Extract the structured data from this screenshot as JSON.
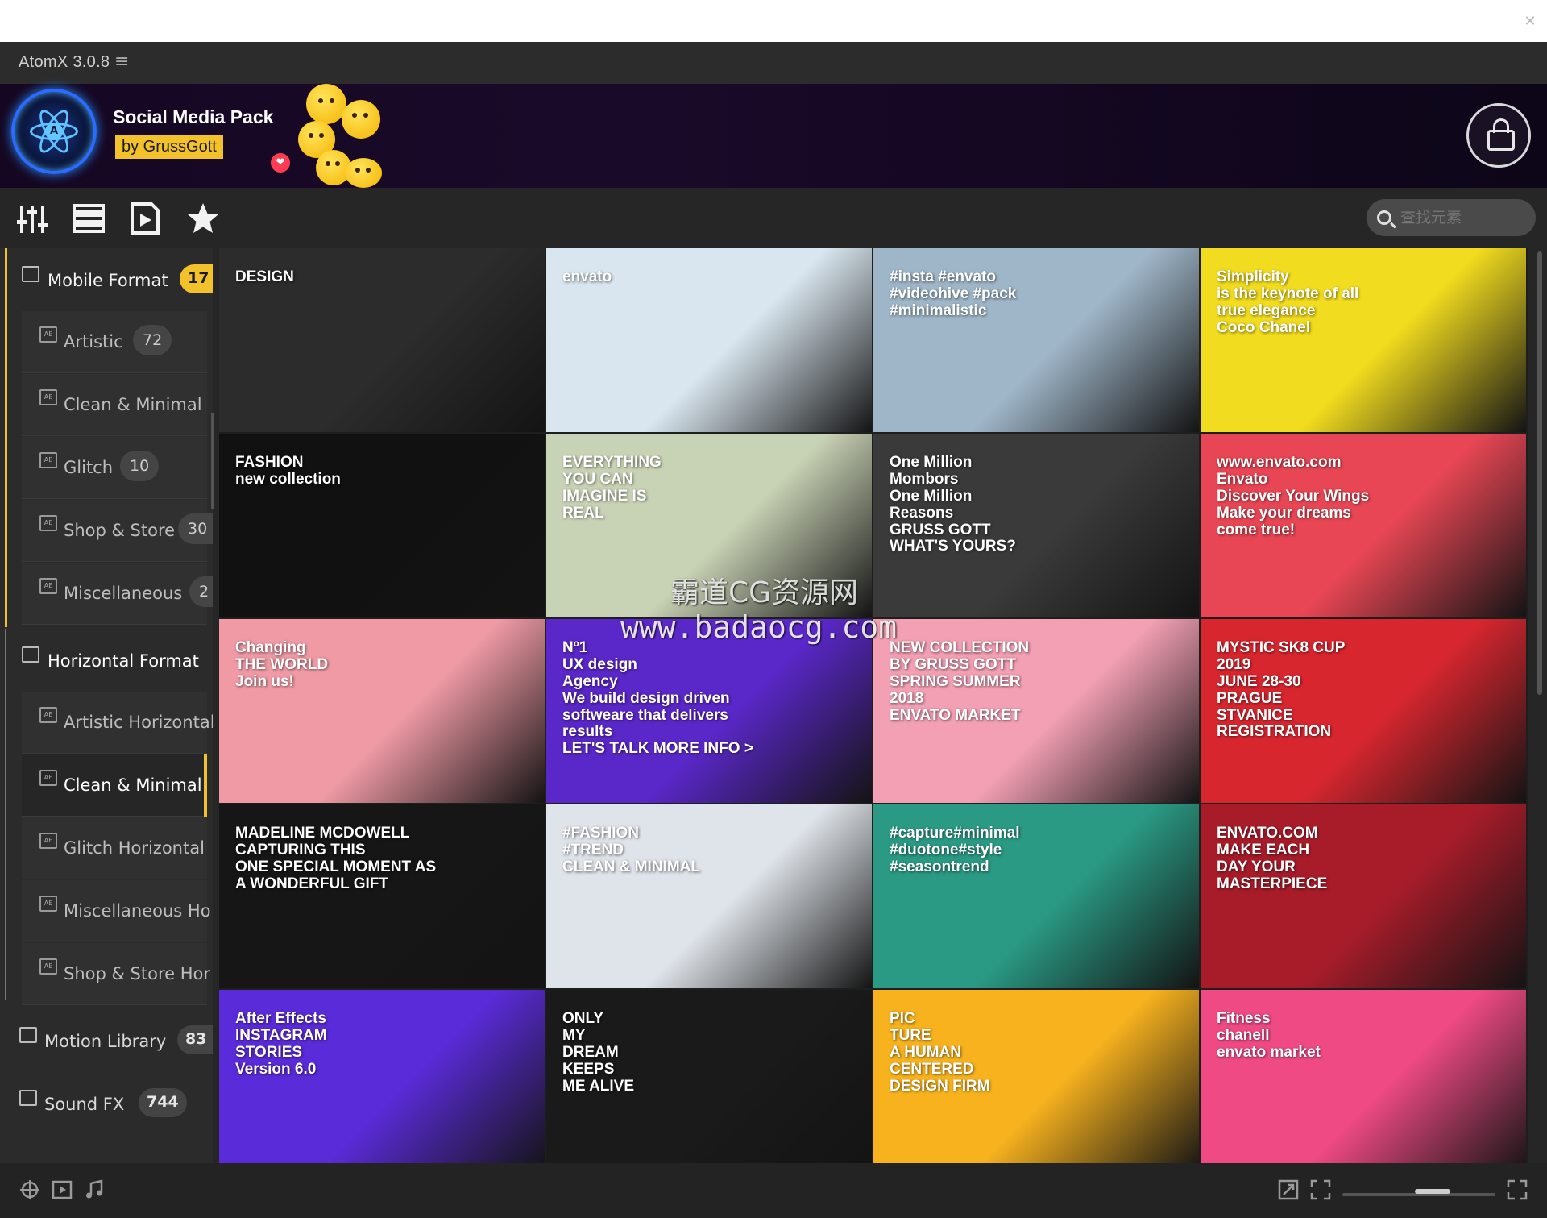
{
  "window": {
    "app_title": "AtomX 3.0.8",
    "menu_glyph": "≡",
    "close_glyph": "✕"
  },
  "banner": {
    "pack_title": "Social Media Pack",
    "author": "by GrussGott",
    "heart": "❤",
    "logo_letter": "A"
  },
  "toolbar": {
    "tools": [
      {
        "name": "sliders-icon"
      },
      {
        "name": "list-icon"
      },
      {
        "name": "preview-icon"
      },
      {
        "name": "star-icon"
      }
    ],
    "search_placeholder": "查找元素"
  },
  "sidebar": {
    "mobile": {
      "label": "Mobile Format",
      "count": "17"
    },
    "mobile_items": [
      {
        "label": "Artistic",
        "count": "72"
      },
      {
        "label": "Clean & Minimal",
        "count": ""
      },
      {
        "label": "Glitch",
        "count": "10"
      },
      {
        "label": "Shop & Store",
        "count": "30"
      },
      {
        "label": "Miscellaneous",
        "count": "2"
      }
    ],
    "horizontal": {
      "label": "Horizontal Format"
    },
    "horizontal_items": [
      {
        "label": "Artistic Horizontal"
      },
      {
        "label": "Clean & Minimal"
      },
      {
        "label": "Glitch Horizontal"
      },
      {
        "label": "Miscellaneous Ho"
      },
      {
        "label": "Shop & Store Hor"
      }
    ],
    "motion": {
      "label": "Motion Library",
      "count": "83"
    },
    "sound": {
      "label": "Sound FX",
      "count": "744"
    }
  },
  "tiles": [
    {
      "name": "tile-design",
      "bg": "#2c2c2c",
      "text": "DESIGN"
    },
    {
      "name": "tile-envato-face",
      "bg": "#d9e6ef",
      "text": "envato"
    },
    {
      "name": "tile-minimalistic",
      "bg": "#9fb6c8",
      "text": "#insta #envato\n#videohive #pack\n#minimalistic"
    },
    {
      "name": "tile-simplicity",
      "bg": "#f2dc1f",
      "text": "Simplicity\nis the keynote of all\ntrue elegance\nCoco Chanel"
    },
    {
      "name": "tile-fashion",
      "bg": "#111111",
      "text": "FASHION\nnew collection"
    },
    {
      "name": "tile-everything",
      "bg": "#c8d2b4",
      "text": "EVERYTHING\nYOU CAN\nIMAGINE IS\nREAL"
    },
    {
      "name": "tile-one-million",
      "bg": "#3a3a3a",
      "text": "One Million\nMombors\nOne Million\nReasons\nGRUSS GOTT\nWHAT'S YOURS?"
    },
    {
      "name": "tile-discover",
      "bg": "#e84654",
      "text": "www.envato.com\nEnvato\nDiscover Your Wings\nMake your dreams\ncome true!"
    },
    {
      "name": "tile-changing-world",
      "bg": "#f09aa5",
      "text": "Changing\nTHE WORLD\nJoin us!"
    },
    {
      "name": "tile-ux-agency",
      "bg": "#5a27c9",
      "text": "Nº1\nUX design\nAgency\nWe build design driven\nsoftweare that delivers\nresults\nLET'S TALK   MORE INFO >"
    },
    {
      "name": "tile-strawberry",
      "bg": "#f3a0b4",
      "text": "NEW COLLECTION\nBY GRUSS GOTT\nSPRING SUMMER\n2018\nENVATO MARKET"
    },
    {
      "name": "tile-mystic",
      "bg": "#d8262f",
      "text": "MYSTIC SK8 CUP\n2019\nJUNE 28-30\nPRAGUE\nSTVANICE\nREGISTRATION"
    },
    {
      "name": "tile-madeline",
      "bg": "#161616",
      "text": "MADELINE MCDOWELL\nCAPTURING THIS\nONE SPECIAL MOMENT AS\nA WONDERFUL GIFT"
    },
    {
      "name": "tile-hash-fashion",
      "bg": "#dfe4ea",
      "text": "#FASHION\n#TREND\nCLEAN & MINIMAL"
    },
    {
      "name": "tile-seasontrend",
      "bg": "#2a9a84",
      "text": "#capture#minimal\n#duotone#style\n#seasontrend"
    },
    {
      "name": "tile-masterpiece",
      "bg": "#a81c2a",
      "text": "ENVATO.COM\nMAKE EACH\nDAY YOUR\nMASTERPIECE"
    },
    {
      "name": "tile-instagram-stories",
      "bg": "#5a2bd8",
      "text": "After Effects\nINSTAGRAM\nSTORIES\nVersion 6.0"
    },
    {
      "name": "tile-only-my-dream",
      "bg": "#1a1a1a",
      "text": "ONLY\nMY\nDREAM\nKEEPS\nME ALIVE"
    },
    {
      "name": "tile-picture",
      "bg": "#f7b21e",
      "text": "PIC\nTURE\nA HUMAN\nCENTERED\nDESIGN FIRM"
    },
    {
      "name": "tile-fitness",
      "bg": "#f04a84",
      "text": "Fitness\nchanell\nenvato market"
    }
  ],
  "watermark": {
    "line1": "霸道CG资源网",
    "line2": "www.badaocg.com"
  },
  "statusbar": {
    "icons": [
      "target-icon",
      "video-icon",
      "music-icon"
    ],
    "right_icons": [
      "resize-icon",
      "crop-icon",
      "expand-icon"
    ]
  },
  "colors": {
    "accent": "#f3c22a",
    "panel": "#2b2b2b",
    "background": "#262626"
  }
}
